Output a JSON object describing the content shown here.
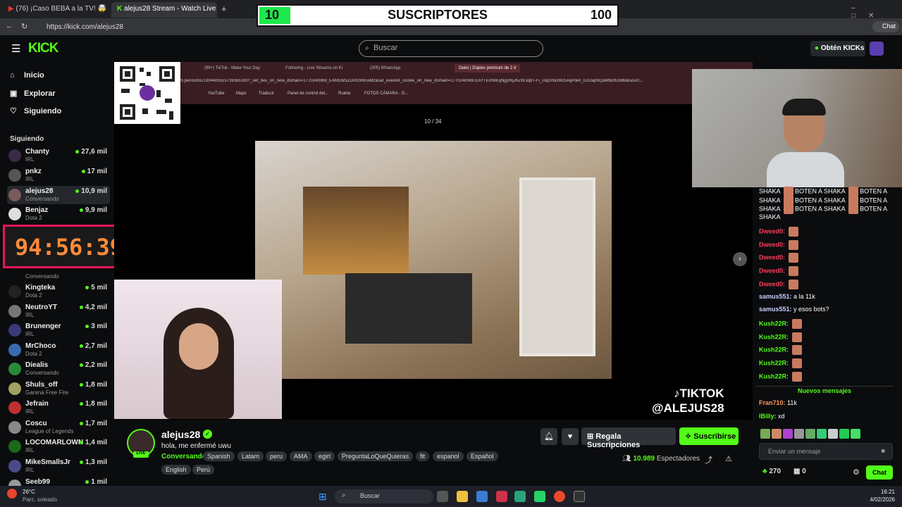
{
  "browser": {
    "tabs": [
      {
        "label": "(76) ¡Caso BEBA a la TV! 🤯 Be",
        "active": false
      },
      {
        "label": "alejus28 Stream - Watch Live",
        "active": true
      }
    ],
    "url": "https://kick.com/alejus28",
    "new_tab": "+"
  },
  "sub_counter": {
    "current": "10",
    "label": "SUSCRIPTORES",
    "goal": "100",
    "progress_fraction": 0.1
  },
  "header": {
    "logo": "KICK",
    "search_placeholder": "Buscar",
    "get_kicks": "Obtén KICKs"
  },
  "nav": [
    {
      "label": "Inicio",
      "icon": "home-icon"
    },
    {
      "label": "Explorar",
      "icon": "compass-icon"
    },
    {
      "label": "Siguiendo",
      "icon": "heart-icon"
    }
  ],
  "following_title": "Siguiendo",
  "following": [
    {
      "name": "Chanty",
      "cat": "IRL",
      "viewers": "27,6 mil"
    },
    {
      "name": "pnkz",
      "cat": "IRL",
      "viewers": "17 mil"
    },
    {
      "name": "alejus28",
      "cat": "Conversando",
      "viewers": "10,9 mil"
    },
    {
      "name": "Benjaz",
      "cat": "Dota 2",
      "viewers": "9,9 mil"
    },
    {
      "name": "Kingteka",
      "cat": "Dota 2",
      "viewers": "5 mil"
    },
    {
      "name": "NeutroYT",
      "cat": "IRL",
      "viewers": "4,2 mil"
    },
    {
      "name": "Brunenger",
      "cat": "IRL",
      "viewers": "3 mil"
    },
    {
      "name": "MrChoco",
      "cat": "Dota 2",
      "viewers": "2,7 mil"
    },
    {
      "name": "Diealis",
      "cat": "Conversando",
      "viewers": "2,2 mil"
    },
    {
      "name": "Shuls_off",
      "cat": "Garena Free Fire",
      "viewers": "1,8 mil"
    },
    {
      "name": "Jefrain",
      "cat": "IRL",
      "viewers": "1,8 mil"
    },
    {
      "name": "Coscu",
      "cat": "League of Legends",
      "viewers": "1,7 mil"
    },
    {
      "name": "LOCOMARLOWN",
      "cat": "IRL",
      "viewers": "1,4 mil"
    },
    {
      "name": "MikeSmallsJr",
      "cat": "IRL",
      "viewers": "1,3 mil"
    },
    {
      "name": "Seeb99",
      "cat": "",
      "viewers": "1 mil"
    }
  ],
  "partial_following": "Conversando",
  "timer": "94:56:39",
  "screen_share": {
    "tabs": [
      "(99+) TikTok - Make Your Day",
      "Following - Live Streams on Ki",
      "(305) WhatsApp",
      "Geko | Dúplex premium de 2 d"
    ],
    "url": "m.pe/rooms/1304405515739365180?_set_bev_on_new_domain=1770240069_EAMGM3ZDI0OWEwMz&set_everest_cookie_on_new_domain=1770240069.EAYTExNWJjNjg3NjJhZW.xq8T-Fi_Uiq1miDM25AqPile0_EcOapNQaMbDKrd8M&sourc...",
    "bookmarks": [
      "YouTube",
      "Maps",
      "Traducir",
      "Panel de control del...",
      "Ruleta",
      "FOTOS CÁMARA - G..."
    ],
    "counter": "10 / 34"
  },
  "watermark": {
    "line1": "♪TIKTOK",
    "line2": "@ALEJUS28"
  },
  "channel": {
    "name": "alejus28",
    "live": "LIVE",
    "title": "hola, me enfermé uwu",
    "category": "Conversando",
    "tags": [
      "Spanish",
      "Latam",
      "peru",
      "AMA",
      "egirl",
      "PreguntaLoQueQuieras",
      "fit",
      "espanol",
      "Español",
      "English",
      "Perú"
    ],
    "gift_label": "Regala Suscripciones",
    "subscribe_label": "Suscribirse",
    "viewers": "10.989",
    "viewers_label": "Espectadores"
  },
  "chat": {
    "spam_lines": [
      [
        "SHAKA",
        "BOTEN A SHAKA",
        "BOTEN A"
      ],
      [
        "SHAKA",
        "BOTEN A SHAKA",
        "BOTEN A"
      ],
      [
        "SHAKA",
        "BOTEN A SHAKA",
        "BOTEN A"
      ],
      [
        "SHAKA",
        "",
        ""
      ]
    ],
    "messages": [
      {
        "user": "Dweed0:",
        "color": "#ff3b5c",
        "text": ""
      },
      {
        "user": "Dweed0:",
        "color": "#ff3b5c",
        "text": ""
      },
      {
        "user": "Dweed0:",
        "color": "#ff3b5c",
        "text": ""
      },
      {
        "user": "Dweed0:",
        "color": "#ff3b5c",
        "text": ""
      },
      {
        "user": "Dweed0:",
        "color": "#ff3b5c",
        "text": ""
      },
      {
        "user": "samus551:",
        "color": "#c8d0ff",
        "text": "a la 11k"
      },
      {
        "user": "samus551:",
        "color": "#c8d0ff",
        "text": "y esos bots?"
      },
      {
        "user": "Kush22R:",
        "color": "#53fc18",
        "text": ""
      },
      {
        "user": "Kush22R:",
        "color": "#53fc18",
        "text": ""
      },
      {
        "user": "Kush22R:",
        "color": "#53fc18",
        "text": ""
      },
      {
        "user": "Kush22R:",
        "color": "#53fc18",
        "text": ""
      },
      {
        "user": "Kush22R:",
        "color": "#53fc18",
        "text": ""
      }
    ],
    "new_messages": "Nuevos mensajes",
    "after": [
      {
        "user": "Fran710:",
        "color": "#ff9a5c",
        "text": "11k"
      },
      {
        "user": "lBilly:",
        "color": "#53fc18",
        "text": "xd"
      }
    ],
    "input_placeholder": "Enviar un mensaje",
    "points": "270",
    "boxes": "0",
    "chat_button": "Chat"
  },
  "taskbar": {
    "weather_temp": "26°C",
    "weather_desc": "Parc. soleado",
    "search": "Buscar",
    "time": "16:21",
    "date": "4/02/2026"
  }
}
